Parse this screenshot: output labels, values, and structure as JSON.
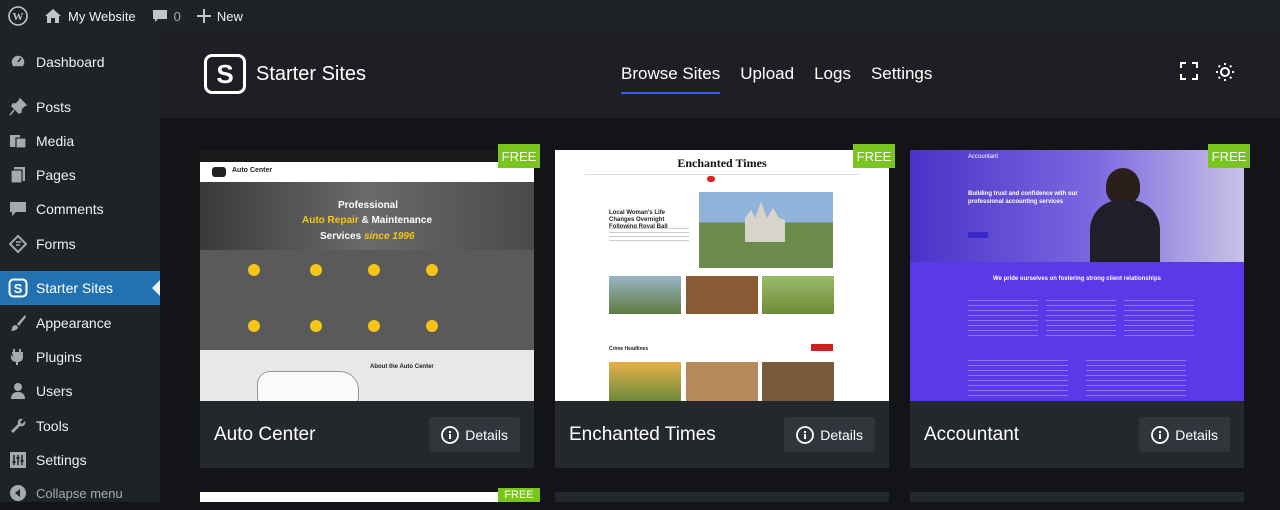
{
  "adminbar": {
    "site_name": "My Website",
    "comments_count": "0",
    "new_label": "New"
  },
  "sidebar": {
    "items": [
      {
        "label": "Dashboard",
        "icon": "dashboard-icon"
      },
      {
        "label": "Posts",
        "icon": "pin-icon"
      },
      {
        "label": "Media",
        "icon": "media-icon"
      },
      {
        "label": "Pages",
        "icon": "pages-icon"
      },
      {
        "label": "Comments",
        "icon": "comment-icon"
      },
      {
        "label": "Forms",
        "icon": "forms-icon"
      },
      {
        "label": "Starter Sites",
        "icon": "starter-sites-icon",
        "active": true
      },
      {
        "label": "Appearance",
        "icon": "brush-icon"
      },
      {
        "label": "Plugins",
        "icon": "plugin-icon"
      },
      {
        "label": "Users",
        "icon": "user-icon"
      },
      {
        "label": "Tools",
        "icon": "wrench-icon"
      },
      {
        "label": "Settings",
        "icon": "settings-icon"
      }
    ],
    "collapse_label": "Collapse menu"
  },
  "header": {
    "app_name": "Starter Sites",
    "nav": [
      {
        "label": "Browse Sites",
        "active": true
      },
      {
        "label": "Upload"
      },
      {
        "label": "Logs"
      },
      {
        "label": "Settings"
      }
    ]
  },
  "cards": [
    {
      "title": "Auto Center",
      "badge": "FREE",
      "details_label": "Details",
      "preview": {
        "brand": "Auto Center",
        "hero_line1": "Professional",
        "hero_line2a": "Auto Repair",
        "hero_line2b": "& Maintenance",
        "hero_line3a": "Services",
        "hero_line3b": "since 1996",
        "about": "About the Auto Center"
      }
    },
    {
      "title": "Enchanted Times",
      "badge": "FREE",
      "details_label": "Details",
      "preview": {
        "masthead": "Enchanted Times",
        "headline": "Local Woman's Life Changes Overnight Following Royal Ball",
        "section": "Crime Headlines"
      }
    },
    {
      "title": "Accountant",
      "badge": "FREE",
      "details_label": "Details",
      "preview": {
        "brand": "Accountant",
        "hero": "Building trust and confidence with our professional accounting services",
        "band": "We pride ourselves on fostering strong client relationships"
      }
    }
  ],
  "second_row_badge": "FREE",
  "colors": {
    "accent": "#2271b1",
    "nav_underline": "#3858e9",
    "badge": "#7ac51d"
  }
}
